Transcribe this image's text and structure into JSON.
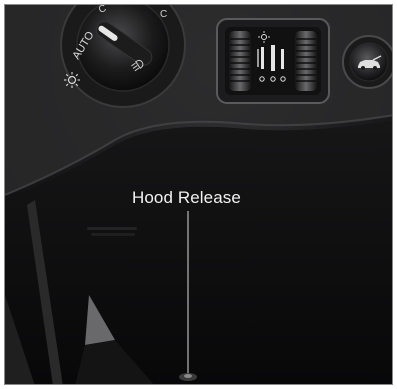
{
  "callout": {
    "label": "Hood Release"
  },
  "headlamp_switch": {
    "auto_label": "AUTO",
    "icons": [
      "dashboard-light-icon",
      "fog-lamp-icon"
    ]
  },
  "dimmer_control": {
    "icons": [
      "sun-icon",
      "dimmer-bars-icon"
    ]
  },
  "trunk_button": {
    "icon": "car-trunk-icon"
  },
  "colors": {
    "panel": "#1a1a1b",
    "trim": "#3a3a3b",
    "label": "#f2f2f2",
    "leader": "#d9d9d9"
  }
}
